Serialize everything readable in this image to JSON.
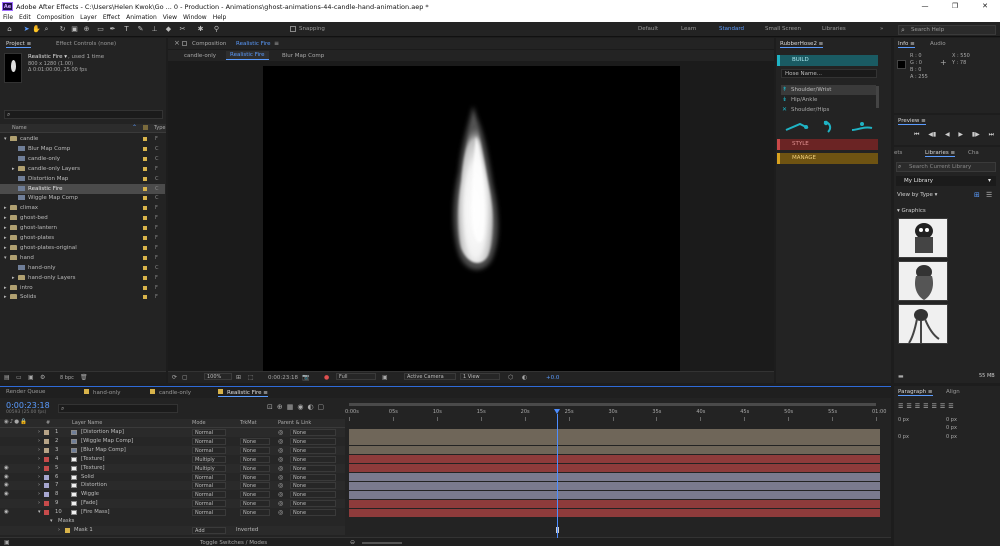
{
  "titlebar": {
    "logo": "Ae",
    "text": "Adobe After Effects - C:\\Users\\Helen Kwok\\Go ... 0 - Production - Animations\\ghost-animations-44-candle-hand-animation.aep *",
    "minimize": "—",
    "maximize": "❐",
    "close": "✕"
  },
  "menu": [
    "File",
    "Edit",
    "Composition",
    "Layer",
    "Effect",
    "Animation",
    "View",
    "Window",
    "Help"
  ],
  "toolbar": {
    "snapping": "Snapping",
    "workspaces": [
      {
        "label": "Default",
        "active": false
      },
      {
        "label": "Learn",
        "active": false
      },
      {
        "label": "Standard",
        "active": true
      },
      {
        "label": "Small Screen",
        "active": false
      },
      {
        "label": "Libraries",
        "active": false
      }
    ],
    "more": "»",
    "search_placeholder": "Search Help"
  },
  "project": {
    "tabs": [
      "Project ≡",
      "Effect Controls (none)"
    ],
    "item_name": "Realistic Fire ▾",
    "item_used": ", used 1 time",
    "item_dims": "800 x 1280 (1.00)",
    "item_dur": "Δ 0:01:00:00, 25.00 fps",
    "search_icon": "⌕",
    "col_name": "Name",
    "col_type": "Type",
    "rows": [
      {
        "label": "candle",
        "indent": 0,
        "kind": "folder",
        "twirl": "open",
        "color": "#d8b34a",
        "type": "F"
      },
      {
        "label": "Blur Map Comp",
        "indent": 2,
        "kind": "comp",
        "twirl": "",
        "color": "#d8b34a",
        "type": "C"
      },
      {
        "label": "candle-only",
        "indent": 2,
        "kind": "comp",
        "twirl": "",
        "color": "#d8b34a",
        "type": "C"
      },
      {
        "label": "candle-only Layers",
        "indent": 2,
        "kind": "folder",
        "twirl": "closed",
        "color": "#d8b34a",
        "type": "F"
      },
      {
        "label": "Distortion Map",
        "indent": 2,
        "kind": "comp",
        "twirl": "",
        "color": "#d8b34a",
        "type": "C"
      },
      {
        "label": "Realistic Fire",
        "indent": 2,
        "kind": "comp",
        "twirl": "",
        "color": "#d8b34a",
        "type": "C",
        "selected": true
      },
      {
        "label": "Wiggle Map Comp",
        "indent": 2,
        "kind": "comp",
        "twirl": "",
        "color": "#d8b34a",
        "type": "C"
      },
      {
        "label": "climax",
        "indent": 0,
        "kind": "folder",
        "twirl": "closed",
        "color": "#d8b34a",
        "type": "F"
      },
      {
        "label": "ghost-bed",
        "indent": 0,
        "kind": "folder",
        "twirl": "closed",
        "color": "#d8b34a",
        "type": "F"
      },
      {
        "label": "ghost-lantern",
        "indent": 0,
        "kind": "folder",
        "twirl": "closed",
        "color": "#d8b34a",
        "type": "F"
      },
      {
        "label": "ghost-plates",
        "indent": 0,
        "kind": "folder",
        "twirl": "closed",
        "color": "#d8b34a",
        "type": "F"
      },
      {
        "label": "ghost-plates-original",
        "indent": 0,
        "kind": "folder",
        "twirl": "closed",
        "color": "#d8b34a",
        "type": "F"
      },
      {
        "label": "hand",
        "indent": 0,
        "kind": "folder",
        "twirl": "open",
        "color": "#d8b34a",
        "type": "F"
      },
      {
        "label": "hand-only",
        "indent": 2,
        "kind": "comp",
        "twirl": "",
        "color": "#d8b34a",
        "type": "C"
      },
      {
        "label": "hand-only Layers",
        "indent": 2,
        "kind": "folder",
        "twirl": "closed",
        "color": "#d8b34a",
        "type": "F"
      },
      {
        "label": "intro",
        "indent": 0,
        "kind": "folder",
        "twirl": "closed",
        "color": "#d8b34a",
        "type": "F"
      },
      {
        "label": "Solids",
        "indent": 0,
        "kind": "folder",
        "twirl": "closed",
        "color": "#d8b34a",
        "type": "F"
      }
    ],
    "bpc": "8 bpc"
  },
  "composition": {
    "tab_prefix": "Composition",
    "tab_name": "Realistic Fire",
    "menu_icon": "≡",
    "breadcrumbs": [
      "candle-only",
      "Realistic Fire",
      "Blur Map Comp"
    ],
    "footer": {
      "zoom": "100%",
      "timecode": "0:00:23:18",
      "resolution": "Full",
      "camera": "Active Camera",
      "views": "1 View",
      "exposure": "+0.0"
    }
  },
  "rubberhose": {
    "title": "RubberHose2 ≡",
    "build": "BUILD",
    "hose_name_placeholder": "Hose Name...",
    "options": [
      "Shoulder/Wrist",
      "Hip/Ankle",
      "Shoulder/Hips"
    ],
    "style": "STYLE",
    "manage": "MANAGE",
    "colors": {
      "build": "#1fb3c4",
      "style": "#c84848",
      "manage": "#d9a21f"
    }
  },
  "info": {
    "tabs": [
      "Info ≡",
      "Audio"
    ],
    "r": "R : 0",
    "g": "G : 0",
    "b": "B : 0",
    "a": "A : 255",
    "x": "X : 550",
    "y": "Y : 78"
  },
  "preview": {
    "title": "Preview ≡",
    "controls": [
      "⏮",
      "◀▮",
      "◀",
      "▶",
      "▮▶",
      "⏭"
    ]
  },
  "libraries": {
    "tabs": [
      "ets",
      "Libraries ≡",
      "Cha"
    ],
    "search_placeholder": "Search Current Library",
    "library": "My Library",
    "view_by": "View by Type ▾",
    "section": "▾ Graphics",
    "size": "55 MB"
  },
  "paragraph": {
    "tabs": [
      "Paragraph ≡",
      "Align"
    ],
    "fields": [
      "0 px",
      "0 px",
      "0 px",
      "0 px",
      "0 px"
    ]
  },
  "timeline": {
    "tabs": [
      {
        "label": "Render Queue",
        "color": ""
      },
      {
        "label": "hand-only",
        "color": "#d8b34a"
      },
      {
        "label": "candle-only",
        "color": "#d8b34a"
      },
      {
        "label": "Realistic Fire",
        "color": "#d8b34a",
        "active": true
      }
    ],
    "timecode": "0:00:23:18",
    "frames": "00593 (25.00 fps)",
    "search_placeholder": "⌕",
    "columns": {
      "hash": "#",
      "layer_name": "Layer Name",
      "mode": "Mode",
      "trkmat": "TrkMat",
      "parent": "Parent & Link"
    },
    "ruler": [
      "0:00s",
      "05s",
      "10s",
      "15s",
      "20s",
      "25s",
      "30s",
      "35s",
      "40s",
      "45s",
      "50s",
      "55s",
      "01:00"
    ],
    "playhead_label": "25s",
    "layers": [
      {
        "num": "1",
        "name": "[Distortion Map]",
        "kind": "comp",
        "color": "#b7a487",
        "mode": "Normal",
        "trkmat": "",
        "parent": "None",
        "eye": false,
        "bar": "#6f6659"
      },
      {
        "num": "2",
        "name": "[Wiggle Map Comp]",
        "kind": "comp",
        "color": "#b7a487",
        "mode": "Normal",
        "trkmat": "None",
        "parent": "None",
        "eye": false,
        "bar": "#6f6659"
      },
      {
        "num": "3",
        "name": "[Blur Map Comp]",
        "kind": "comp",
        "color": "#b7a487",
        "mode": "Normal",
        "trkmat": "None",
        "parent": "None",
        "eye": false,
        "bar": "#6f6659"
      },
      {
        "num": "4",
        "name": "[Texture]",
        "kind": "solid",
        "color": "#c74b4b",
        "mode": "Multiply",
        "trkmat": "None",
        "parent": "None",
        "eye": false,
        "bar": "#8e3b3b"
      },
      {
        "num": "5",
        "name": "[Texture]",
        "kind": "solid",
        "color": "#c74b4b",
        "mode": "Multiply",
        "trkmat": "None",
        "parent": "None",
        "eye": true,
        "bar": "#8e3b3b"
      },
      {
        "num": "6",
        "name": "Solid",
        "kind": "solid",
        "color": "#a7a7d0",
        "mode": "Normal",
        "trkmat": "None",
        "parent": "None",
        "eye": true,
        "bar": "#7a7a8e"
      },
      {
        "num": "7",
        "name": "Distortion",
        "kind": "solid",
        "color": "#a7a7d0",
        "mode": "Normal",
        "trkmat": "None",
        "parent": "None",
        "eye": true,
        "bar": "#7a7a8e"
      },
      {
        "num": "8",
        "name": "Wiggle",
        "kind": "solid",
        "color": "#a7a7d0",
        "mode": "Normal",
        "trkmat": "None",
        "parent": "None",
        "eye": true,
        "bar": "#7a7a8e"
      },
      {
        "num": "9",
        "name": "[Fade]",
        "kind": "solid",
        "color": "#c74b4b",
        "mode": "Normal",
        "trkmat": "None",
        "parent": "None",
        "eye": false,
        "bar": "#8e3b3b"
      },
      {
        "num": "10",
        "name": "[Fire Mass]",
        "kind": "solid",
        "color": "#c74b4b",
        "mode": "Normal",
        "trkmat": "None",
        "parent": "None",
        "eye": true,
        "bar": "#8e3b3b"
      }
    ],
    "masks_label": "Masks",
    "mask1": "Mask 1",
    "mask_mode": "Add",
    "mask_inverted": "Inverted",
    "footer": "Toggle Switches / Modes"
  }
}
